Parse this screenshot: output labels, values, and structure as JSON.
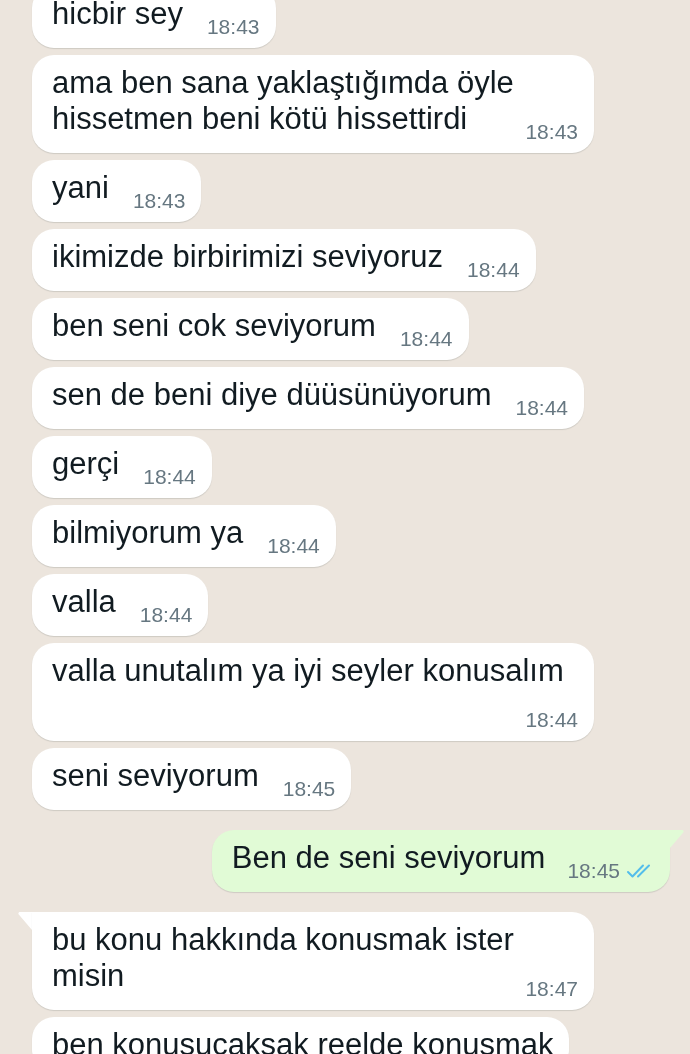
{
  "messages": [
    {
      "kind": "incoming",
      "tail": false,
      "text": "hicbir sey",
      "time": "18:43"
    },
    {
      "kind": "incoming",
      "tail": false,
      "text": "ama ben sana yaklaştığımda öyle hissetmen beni kötü hissettirdi",
      "time": "18:43"
    },
    {
      "kind": "incoming",
      "tail": false,
      "text": "yani",
      "time": "18:43"
    },
    {
      "kind": "incoming",
      "tail": false,
      "text": "ikimizde birbirimizi seviyoruz",
      "time": "18:44"
    },
    {
      "kind": "incoming",
      "tail": false,
      "text": "ben seni cok seviyorum",
      "time": "18:44"
    },
    {
      "kind": "incoming",
      "tail": false,
      "text": "sen de beni diye düüsünüyorum",
      "time": "18:44"
    },
    {
      "kind": "incoming",
      "tail": false,
      "text": "gerçi",
      "time": "18:44"
    },
    {
      "kind": "incoming",
      "tail": false,
      "text": "bilmiyorum ya",
      "time": "18:44"
    },
    {
      "kind": "incoming",
      "tail": false,
      "text": "valla",
      "time": "18:44"
    },
    {
      "kind": "incoming",
      "tail": false,
      "text": "valla unutalım ya iyi seyler konusalım",
      "time": "18:44"
    },
    {
      "kind": "incoming",
      "tail": false,
      "text": "seni seviyorum",
      "time": "18:45"
    },
    {
      "kind": "outgoing",
      "tail": true,
      "text": "Ben de seni seviyorum",
      "time": "18:45",
      "read": true
    },
    {
      "kind": "incoming",
      "tail": true,
      "text": "bu konu hakkında konusmak ister misin",
      "time": "18:47"
    },
    {
      "kind": "incoming",
      "tail": false,
      "text": "ben konusucaksak reelde konusmak"
    }
  ]
}
